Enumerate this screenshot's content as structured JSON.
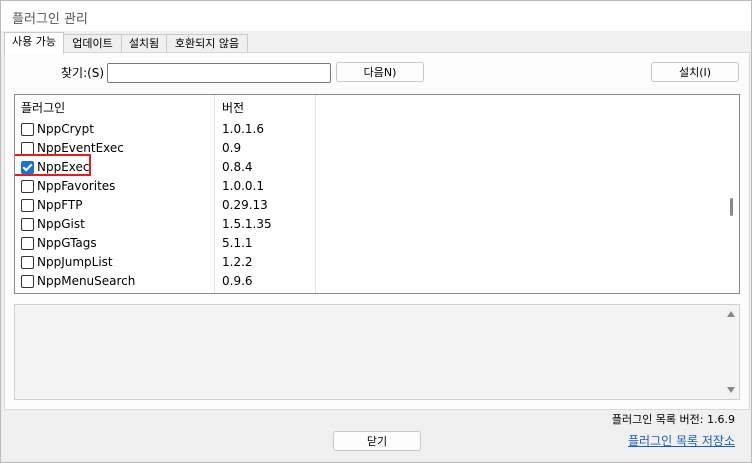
{
  "window": {
    "title": "플러그인 관리"
  },
  "tabs": [
    {
      "label": "사용 가능",
      "active": true
    },
    {
      "label": "업데이트",
      "active": false
    },
    {
      "label": "설치됨",
      "active": false
    },
    {
      "label": "호환되지 않음",
      "active": false
    }
  ],
  "search": {
    "label": "찾기:(S)",
    "value": ""
  },
  "buttons": {
    "next": "다음N)",
    "install": "설치(I)",
    "close": "닫기"
  },
  "table": {
    "columns": [
      "플러그인",
      "버전"
    ],
    "rows": [
      {
        "name": "NppCrypt",
        "version": "1.0.1.6",
        "checked": false
      },
      {
        "name": "NppEventExec",
        "version": "0.9",
        "checked": false
      },
      {
        "name": "NppExec",
        "version": "0.8.4",
        "checked": true,
        "highlighted": true
      },
      {
        "name": "NppFavorites",
        "version": "1.0.0.1",
        "checked": false
      },
      {
        "name": "NppFTP",
        "version": "0.29.13",
        "checked": false
      },
      {
        "name": "NppGist",
        "version": "1.5.1.35",
        "checked": false
      },
      {
        "name": "NppGTags",
        "version": "5.1.1",
        "checked": false
      },
      {
        "name": "NppJumpList",
        "version": "1.2.2",
        "checked": false
      },
      {
        "name": "NppMenuSearch",
        "version": "0.9.6",
        "checked": false
      }
    ]
  },
  "footer": {
    "list_version_label": "플러그인 목록 버전:",
    "list_version_value": "1.6.9",
    "repo_link": "플러그인 목록 저장소"
  },
  "colors": {
    "checkbox_checked": "#1a73c9",
    "highlight_border": "#e02020",
    "link": "#1a5fb4"
  }
}
